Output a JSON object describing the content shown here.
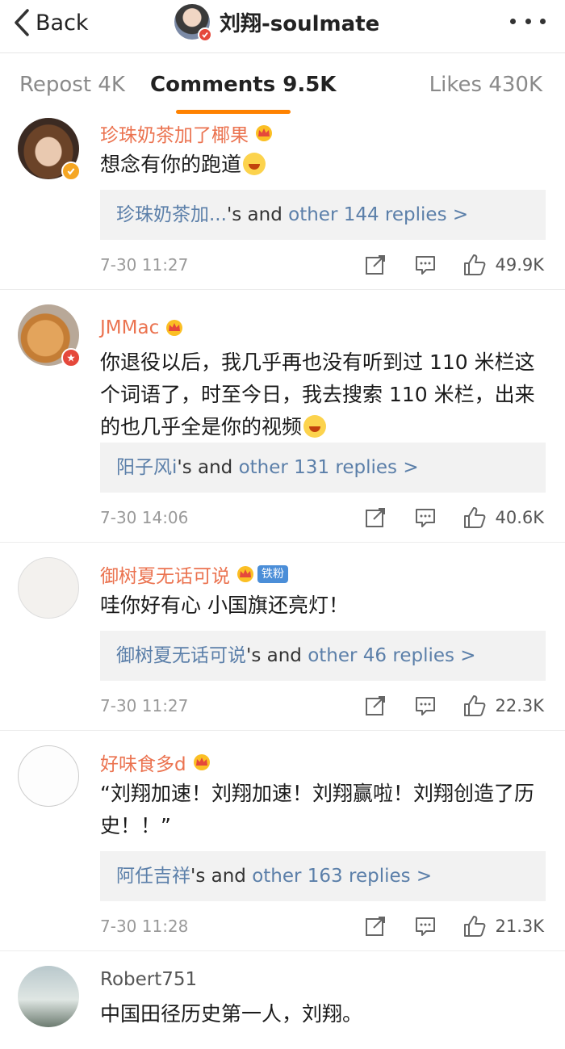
{
  "header": {
    "back_label": "Back",
    "title": "刘翔-soulmate"
  },
  "tabs": {
    "repost": "Repost 4K",
    "comments": "Comments 9.5K",
    "likes": "Likes 430K"
  },
  "colors": {
    "accent": "#ff8200",
    "username": "#eb7350",
    "reply_link": "#5b7fa9",
    "verified_badge": "#f5a623"
  },
  "comments": [
    {
      "user": "珍珠奶茶加了椰果",
      "text": "想念有你的跑道",
      "reply_user": "珍珠奶茶加...",
      "reply_mid": "'s and ",
      "reply_link": "other 144 replies >",
      "time": "7-30 11:27",
      "likes": "49.9K"
    },
    {
      "user": "JMMac",
      "text": "你退役以后，我几乎再也没有听到过 110 米栏这个词语了，时至今日，我去搜索 110 米栏，出来的也几乎全是你的视频",
      "reply_user": "阳子风i",
      "reply_mid": "'s and ",
      "reply_link": "other 131 replies >",
      "time": "7-30 14:06",
      "likes": "40.6K"
    },
    {
      "user": "御树夏无话可说",
      "fan_badge": "铁粉",
      "text": "哇你好有心  小国旗还亮灯！",
      "reply_user": "御树夏无话可说",
      "reply_mid": "'s and ",
      "reply_link": "other 46 replies >",
      "time": "7-30 11:27",
      "likes": "22.3K"
    },
    {
      "user": "好味食多d",
      "text": "“刘翔加速！刘翔加速！刘翔赢啦！刘翔创造了历史！！”",
      "reply_user": "阿任吉祥",
      "reply_mid": "'s and ",
      "reply_link": "other 163 replies >",
      "time": "7-30 11:28",
      "likes": "21.3K"
    },
    {
      "user": "Robert751",
      "text": "中国田径历史第一人，刘翔。"
    }
  ]
}
